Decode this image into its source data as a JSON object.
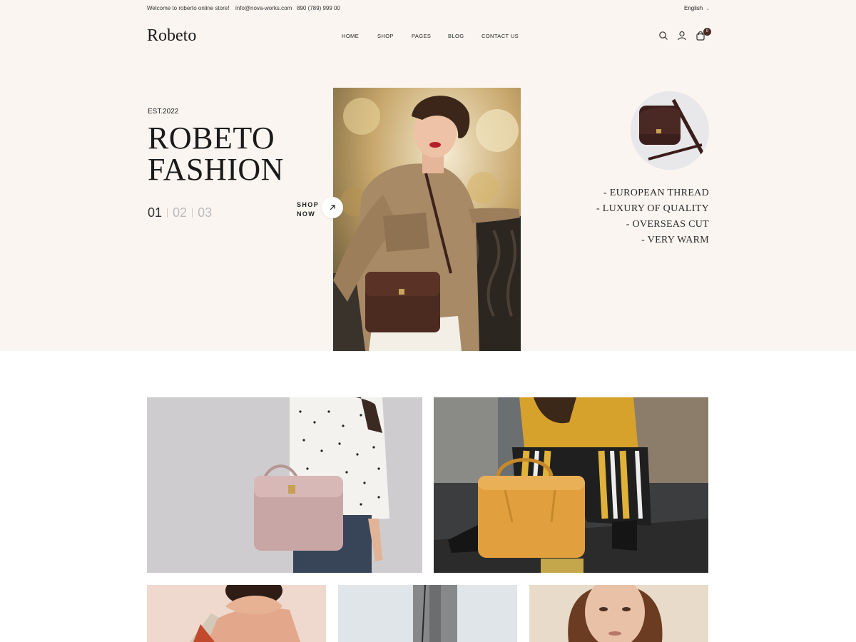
{
  "topbar": {
    "welcome": "Welcome to roberto online store!",
    "email": "info@nova-works.com",
    "phone": "890 (789) 999 00",
    "language": "English"
  },
  "header": {
    "logo": "Robeto",
    "nav": [
      "HOME",
      "SHOP",
      "PAGES",
      "BLOG",
      "CONTACT US"
    ],
    "cart_count": "0",
    "icons": [
      "search-icon",
      "user-icon",
      "cart-icon"
    ]
  },
  "hero": {
    "est": "EST.2022",
    "title_line1": "ROBETO",
    "title_line2": "FASHION",
    "slides": [
      "01",
      "02",
      "03"
    ],
    "shop_now_line1": "SHOP",
    "shop_now_line2": "NOW",
    "features": [
      "- EUROPEAN THREAD",
      "- LUXURY OF QUALITY",
      "- OVERSEAS CUT",
      "- VERY WARM"
    ]
  },
  "colors": {
    "background": "#faf5f1",
    "accent": "#4a2a22",
    "text": "#1a1a1a"
  }
}
